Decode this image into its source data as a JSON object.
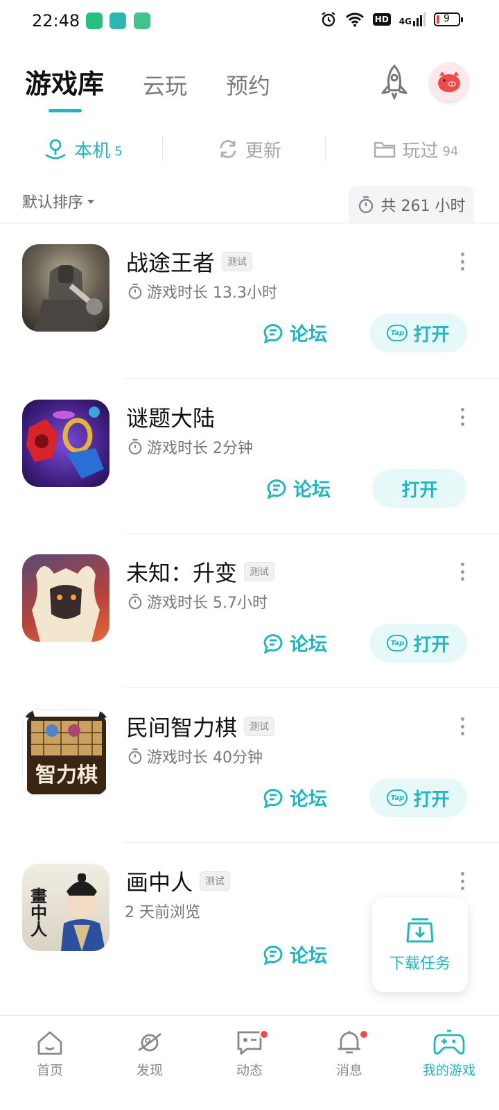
{
  "status_bar": {
    "time": "22:48",
    "hd": "HD",
    "network": "4G",
    "battery": "9"
  },
  "header": {
    "tabs": [
      {
        "label": "游戏库",
        "active": true
      },
      {
        "label": "云玩",
        "active": false
      },
      {
        "label": "预约",
        "active": false
      }
    ],
    "rocket_icon": "rocket-icon",
    "avatar_icon": "pig-avatar"
  },
  "subtabs": [
    {
      "label": "本机",
      "count": "5",
      "icon": "local-device-icon",
      "active": true
    },
    {
      "label": "更新",
      "count": "",
      "icon": "refresh-icon",
      "active": false
    },
    {
      "label": "玩过",
      "count": "94",
      "icon": "folder-icon",
      "active": false
    }
  ],
  "sort": {
    "label": "默认排序",
    "total_time": "共 261 小时"
  },
  "games": [
    {
      "name": "战途王者",
      "badge": "测试",
      "time": "游戏时长 13.3小时",
      "forum": "论坛",
      "open": "打开",
      "open_has_tap_icon": true
    },
    {
      "name": "谜题大陆",
      "badge": "",
      "time": "游戏时长 2分钟",
      "forum": "论坛",
      "open": "打开",
      "open_has_tap_icon": false
    },
    {
      "name": "未知：升变",
      "badge": "测试",
      "time": "游戏时长 5.7小时",
      "forum": "论坛",
      "open": "打开",
      "open_has_tap_icon": true
    },
    {
      "name": "民间智力棋",
      "badge": "测试",
      "time": "游戏时长 40分钟",
      "forum": "论坛",
      "open": "打开",
      "open_has_tap_icon": true,
      "icon_text": "智力棋"
    },
    {
      "name": "画中人",
      "badge": "测试",
      "time": "2 天前浏览",
      "forum": "论坛",
      "open": "",
      "open_has_tap_icon": false,
      "icon_text": "畫中人"
    }
  ],
  "download_card": {
    "label": "下载任务"
  },
  "bottom_nav": [
    {
      "label": "首页",
      "icon": "home-icon",
      "active": false,
      "dot": false
    },
    {
      "label": "发现",
      "icon": "planet-icon",
      "active": false,
      "dot": false
    },
    {
      "label": "动态",
      "icon": "chat-icon",
      "active": false,
      "dot": true
    },
    {
      "label": "消息",
      "icon": "bell-icon",
      "active": false,
      "dot": true
    },
    {
      "label": "我的游戏",
      "icon": "gamepad-icon",
      "active": true,
      "dot": false
    }
  ],
  "colors": {
    "accent": "#1fb6c1",
    "badge_dot": "#f04b4b"
  }
}
